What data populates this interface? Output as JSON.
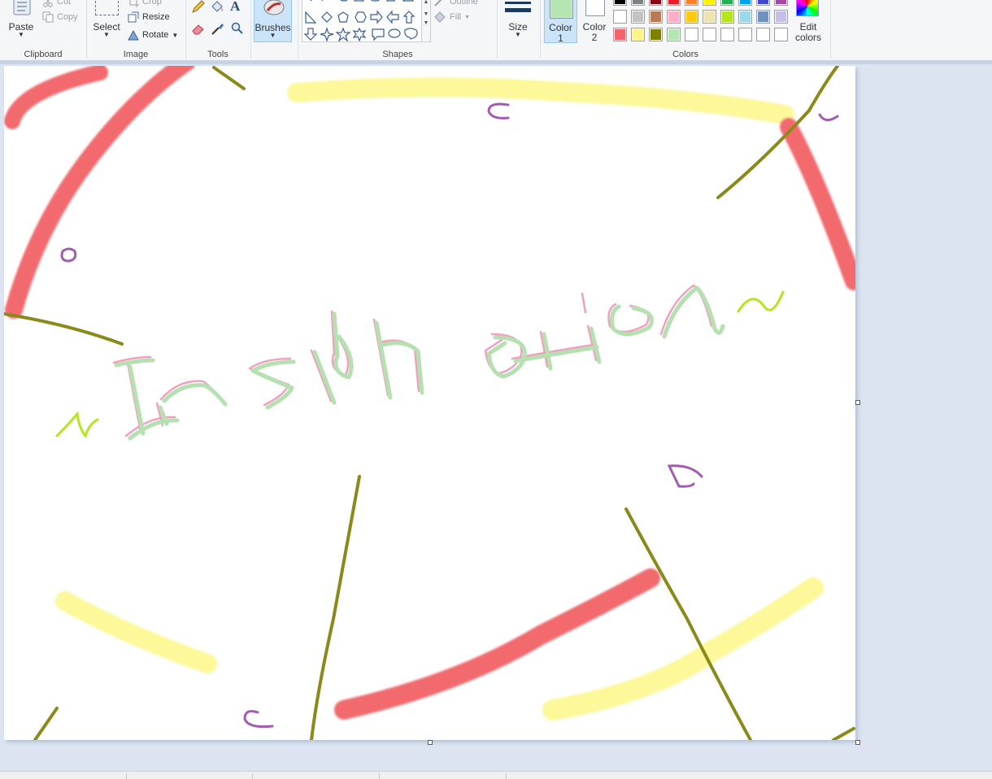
{
  "ribbon": {
    "clipboard": {
      "group_label": "Clipboard",
      "paste_label": "Paste",
      "cut_label": "Cut",
      "copy_label": "Copy"
    },
    "image": {
      "group_label": "Image",
      "select_label": "Select",
      "crop_label": "Crop",
      "resize_label": "Resize",
      "rotate_label": "Rotate"
    },
    "tools": {
      "group_label": "Tools",
      "items": [
        "pencil-icon",
        "fill-icon",
        "text-icon",
        "eraser-icon",
        "color-picker-icon",
        "magnifier-icon"
      ]
    },
    "brushes": {
      "label": "Brushes",
      "selected": true
    },
    "shapes": {
      "group_label": "Shapes",
      "outline_label": "Outline",
      "fill_label": "Fill"
    },
    "size": {
      "label": "Size"
    },
    "colors": {
      "group_label": "Colors",
      "color1_label": "Color",
      "color1_num": "1",
      "color1_value": "#b5e6b1",
      "color2_label": "Color",
      "color2_num": "2",
      "color2_value": "#ffffff",
      "edit_label": "Edit",
      "edit_label2": "colors",
      "palette_row1": [
        "#000000",
        "#7f7f7f",
        "#880015",
        "#ed1c24",
        "#ff7f27",
        "#fff200",
        "#22b14c",
        "#00a2e8",
        "#3f48cc",
        "#a349a4"
      ],
      "palette_row2": [
        "#ffffff",
        "#c3c3c3",
        "#b97a57",
        "#ffaec9",
        "#ffc90e",
        "#efe4b0",
        "#b5e61d",
        "#99d9ea",
        "#7092be",
        "#c8bfe7"
      ],
      "palette_row3": [
        "#f2636b",
        "#fdf58a",
        "#808000",
        "#b5e6b1",
        "#ffffff",
        "#ffffff",
        "#ffffff",
        "#ffffff",
        "#ffffff",
        "#ffffff"
      ]
    }
  },
  "canvas": {
    "drawing_description_colors": {
      "red": "#f26b6e",
      "yellow": "#fdf89a",
      "olive": "#8a8a1a",
      "purple": "#a35ab3",
      "green": "#b5e0b0",
      "lime": "#b5e61d",
      "pink": "#f0a0c0"
    }
  }
}
